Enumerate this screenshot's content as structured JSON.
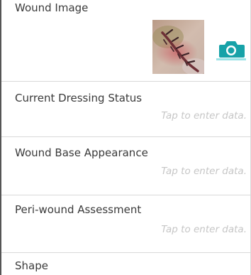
{
  "form": {
    "wound_image": {
      "label": "Wound Image",
      "thumbnail_icon": "wound-photo-thumbnail",
      "camera_icon": "camera-icon",
      "camera_color": "#17a2a8"
    },
    "fields": [
      {
        "label": "Current Dressing Status",
        "hint": "Tap to enter data."
      },
      {
        "label": "Wound Base Appearance",
        "hint": "Tap to enter data."
      },
      {
        "label": "Peri-wound Assessment",
        "hint": "Tap to enter data."
      },
      {
        "label": "Shape"
      }
    ],
    "hint_color": "#c6c6c6",
    "divider_color": "#d9d9d9"
  }
}
